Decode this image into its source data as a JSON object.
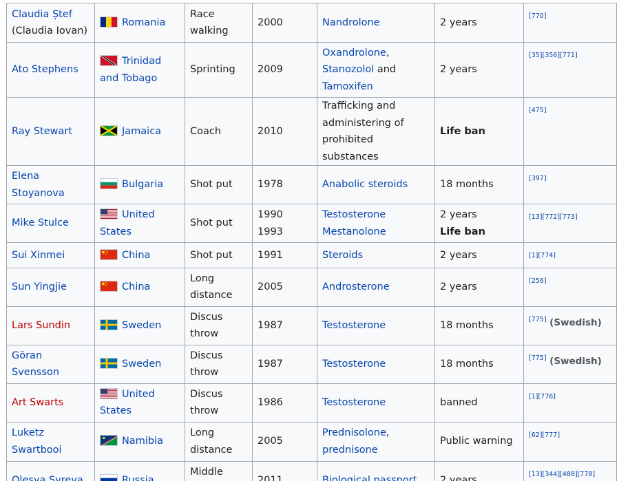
{
  "rows": [
    {
      "name": "Claudia Ștef",
      "name2": "(Claudia Iovan)",
      "name_red": false,
      "country": "Romania",
      "flag": "romania-flag-icon",
      "event": "Race walking",
      "year": "2000",
      "substance": [
        {
          "t": "Nandrolone",
          "link": true
        }
      ],
      "sanction": "2 years",
      "sanction_bold": false,
      "sanction2": "",
      "refs": "[770]",
      "lang": ""
    },
    {
      "name": "Ato Stephens",
      "name2": "",
      "name_red": false,
      "country": "Trinidad and Tobago",
      "flag": "trinidad-and-tobago-flag-icon",
      "event": "Sprinting",
      "year": "2009",
      "substance": [
        {
          "t": "Oxandrolone",
          "link": true
        },
        {
          "t": ", ",
          "link": false
        },
        {
          "t": "Stanozolol",
          "link": true
        },
        {
          "t": " and ",
          "link": false
        },
        {
          "t": "Tamoxifen",
          "link": true
        }
      ],
      "sanction": "2 years",
      "sanction_bold": false,
      "sanction2": "",
      "refs": "[35][356][771]",
      "lang": ""
    },
    {
      "name": "Ray Stewart",
      "name2": "",
      "name_red": false,
      "country": "Jamaica",
      "flag": "jamaica-flag-icon",
      "event": "Coach",
      "year": "2010",
      "substance": [
        {
          "t": "Trafficking and administering of prohibited substances",
          "link": false
        }
      ],
      "sanction": "Life ban",
      "sanction_bold": true,
      "sanction2": "",
      "refs": "[475]",
      "lang": ""
    },
    {
      "name": "Elena Stoyanova",
      "name2": "",
      "name_red": false,
      "country": "Bulgaria",
      "flag": "bulgaria-flag-icon",
      "event": "Shot put",
      "year": "1978",
      "substance": [
        {
          "t": "Anabolic steroids",
          "link": true
        }
      ],
      "sanction": "18 months",
      "sanction_bold": false,
      "sanction2": "",
      "refs": "[397]",
      "lang": ""
    },
    {
      "name": "Mike Stulce",
      "name2": "",
      "name_red": false,
      "country": "United States",
      "flag": "united-states-flag-icon",
      "event": "Shot put",
      "year": "1990",
      "year2": "1993",
      "substance": [
        {
          "t": "Testosterone",
          "link": true
        }
      ],
      "substance2": "Mestanolone",
      "sanction": "2 years",
      "sanction_bold": false,
      "sanction2": "Life ban",
      "refs": "[13][772][773]",
      "lang": ""
    },
    {
      "name": "Sui Xinmei",
      "name2": "",
      "name_red": false,
      "country": "China",
      "flag": "china-flag-icon",
      "event": "Shot put",
      "year": "1991",
      "substance": [
        {
          "t": "Steroids",
          "link": true
        }
      ],
      "sanction": "2 years",
      "sanction_bold": false,
      "sanction2": "",
      "refs": "[1][774]",
      "lang": ""
    },
    {
      "name": "Sun Yingjie",
      "name2": "",
      "name_red": false,
      "country": "China",
      "flag": "china-flag-icon",
      "event": "Long distance",
      "year": "2005",
      "substance": [
        {
          "t": "Androsterone",
          "link": true
        }
      ],
      "sanction": "2 years",
      "sanction_bold": false,
      "sanction2": "",
      "refs": "[256]",
      "lang": ""
    },
    {
      "name": "Lars Sundin",
      "name2": "",
      "name_red": true,
      "country": "Sweden",
      "flag": "sweden-flag-icon",
      "event": "Discus throw",
      "year": "1987",
      "substance": [
        {
          "t": "Testosterone",
          "link": true
        }
      ],
      "sanction": "18 months",
      "sanction_bold": false,
      "sanction2": "",
      "refs": "[775]",
      "lang": "(Swedish)"
    },
    {
      "name": "Göran Svensson",
      "name2": "",
      "name_red": false,
      "country": "Sweden",
      "flag": "sweden-flag-icon",
      "event": "Discus throw",
      "year": "1987",
      "substance": [
        {
          "t": "Testosterone",
          "link": true
        }
      ],
      "sanction": "18 months",
      "sanction_bold": false,
      "sanction2": "",
      "refs": "[775]",
      "lang": "(Swedish)"
    },
    {
      "name": "Art Swarts",
      "name2": "",
      "name_red": true,
      "country": "United States",
      "flag": "united-states-flag-icon",
      "event": "Discus throw",
      "year": "1986",
      "substance": [
        {
          "t": "Testosterone",
          "link": true
        }
      ],
      "sanction": "banned",
      "sanction_bold": false,
      "sanction2": "",
      "refs": "[1][776]",
      "lang": ""
    },
    {
      "name": "Luketz Swartbooi",
      "name2": "",
      "name_red": false,
      "country": "Namibia",
      "flag": "namibia-flag-icon",
      "event": "Long distance",
      "year": "2005",
      "substance": [
        {
          "t": "Prednisolone",
          "link": true
        },
        {
          "t": ", ",
          "link": false
        },
        {
          "t": "prednisone",
          "link": true
        }
      ],
      "sanction": "Public warning",
      "sanction_bold": false,
      "sanction2": "",
      "refs": "[62][777]",
      "lang": ""
    },
    {
      "name": "Olesya Syreva",
      "name2": "",
      "name_red": false,
      "country": "Russia",
      "flag": "russia-flag-icon",
      "event": "Middle distance",
      "year": "2011",
      "substance": [
        {
          "t": "Biological passport",
          "link": true
        }
      ],
      "sanction": "2 years",
      "sanction_bold": false,
      "sanction2": "",
      "refs": "[13][344][488][778]",
      "lang": ""
    }
  ]
}
